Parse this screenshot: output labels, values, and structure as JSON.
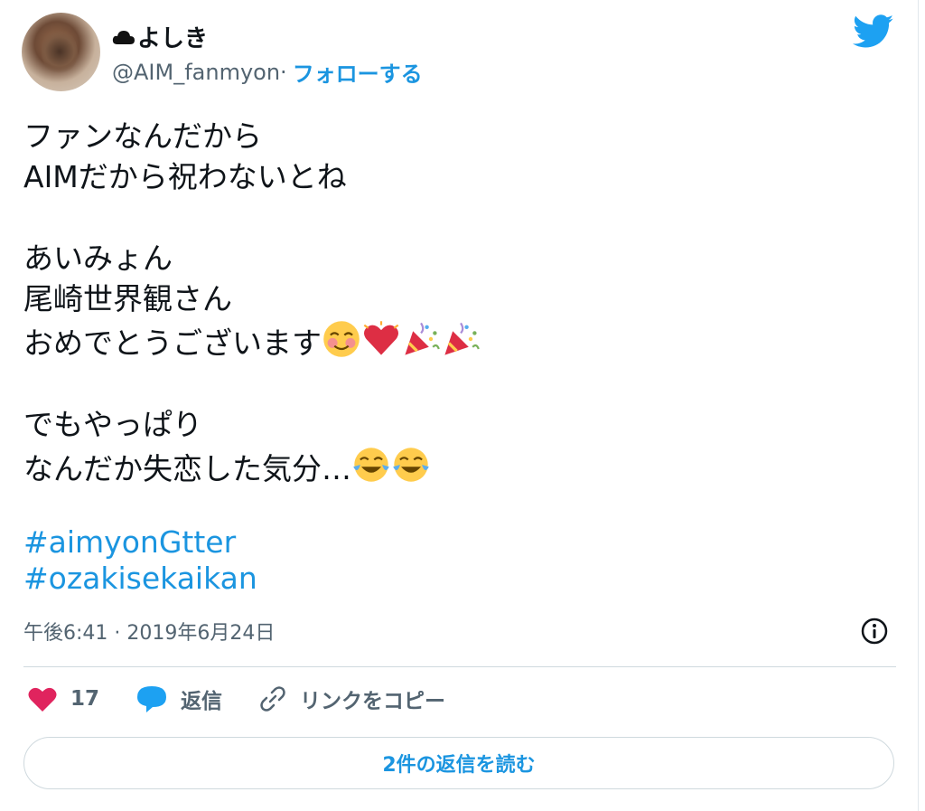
{
  "user": {
    "name": "よしき",
    "handle": "@AIM_fanmyon",
    "separator": " · ",
    "follow_label": "フォローする"
  },
  "tweet": {
    "lines": [
      "ファンなんだから",
      "AIMだから祝わないとね",
      "",
      "あいみょん",
      "尾崎世界観さん",
      "おめでとうございます",
      "",
      "でもやっぱり",
      "なんだか失恋した気分…"
    ],
    "hashtags": [
      "#aimyonGtter",
      "#ozakisekaikan"
    ],
    "timestamp": "午後6:41 · 2019年6月24日"
  },
  "actions": {
    "like_count": "17",
    "reply_label": "返信",
    "copy_link_label": "リンクをコピー"
  },
  "read_replies_label": "2件の返信を読む",
  "colors": {
    "accent": "#1b95e0",
    "like": "#e0245e",
    "text": "#0f1419",
    "muted": "#536471"
  }
}
